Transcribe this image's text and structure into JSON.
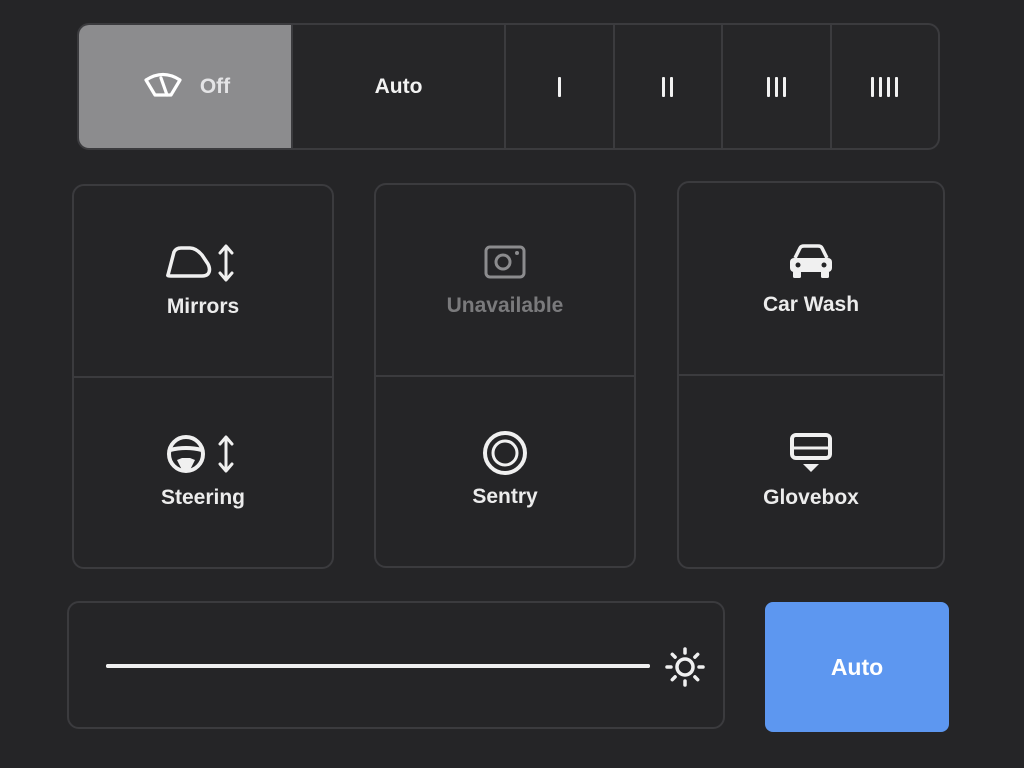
{
  "wipers": {
    "off_label": "Off",
    "auto_label": "Auto",
    "speed_levels": [
      1,
      2,
      3,
      4
    ],
    "selected": "Off"
  },
  "controls": {
    "mirrors_label": "Mirrors",
    "steering_label": "Steering",
    "camera_label": "Unavailable",
    "sentry_label": "Sentry",
    "car_wash_label": "Car Wash",
    "glovebox_label": "Glovebox"
  },
  "brightness": {
    "level": 1.0,
    "auto_label": "Auto"
  },
  "colors": {
    "background": "#252527",
    "border": "#3b3b3e",
    "selected_segment": "#8c8c8e",
    "accent": "#5d97f0",
    "disabled_text": "#7a7a7c"
  },
  "icons": {
    "wiper": "wiper-icon",
    "mirror": "mirror-adjust-icon",
    "steering": "steering-wheel-adjust-icon",
    "camera": "dashcam-icon",
    "sentry": "sentry-icon",
    "car_wash": "car-front-icon",
    "glovebox": "glovebox-icon",
    "brightness": "sun-icon"
  }
}
